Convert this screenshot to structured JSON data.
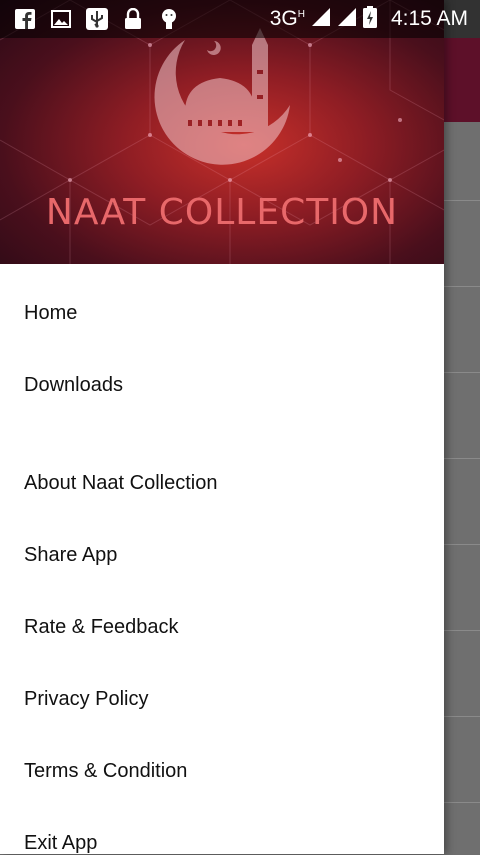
{
  "status_bar": {
    "network": "3G",
    "network_sup": "H",
    "time": "4:15 AM",
    "icons": [
      "facebook-icon",
      "image-icon",
      "usb-icon",
      "lock-icon",
      "android-debug-icon",
      "signal-icon",
      "signal-icon-2",
      "battery-charging-icon"
    ]
  },
  "drawer": {
    "header_title": "NAAT COLLECTION",
    "items": [
      {
        "label": "Home"
      },
      {
        "label": "Downloads"
      },
      {
        "label": "About Naat Collection"
      },
      {
        "label": "Share App"
      },
      {
        "label": "Rate & Feedback"
      },
      {
        "label": "Privacy Policy"
      },
      {
        "label": "Terms & Condition"
      },
      {
        "label": "Exit App"
      }
    ]
  },
  "colors": {
    "header_red": "#c8302a",
    "toolbar_bg": "#5d1029",
    "title_text": "#e8686a"
  }
}
